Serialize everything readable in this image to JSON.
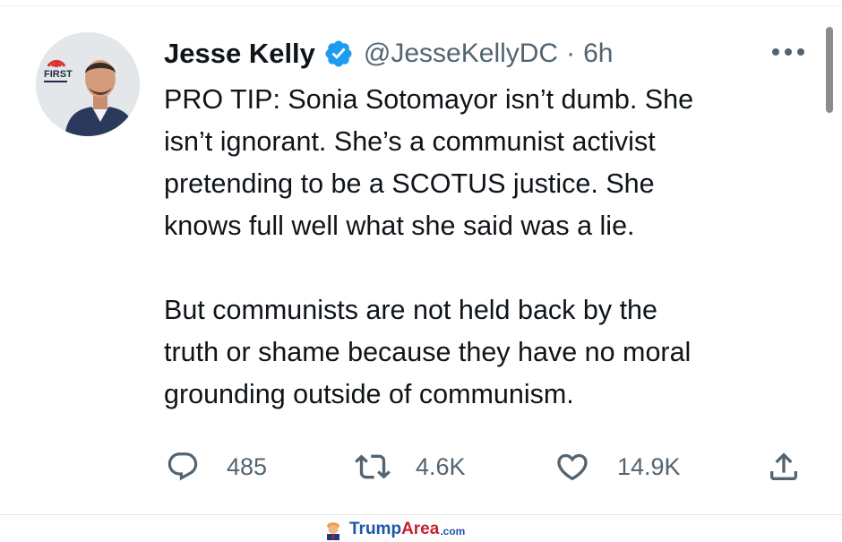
{
  "tweet": {
    "author_name": "Jesse Kelly",
    "handle": "@JesseKellyDC",
    "separator": "·",
    "time": "6h",
    "avatar_badge_text": "FIRST",
    "lines_paragraph_1": [
      "PRO TIP: Sonia Sotomayor isn’t dumb. She",
      "isn’t ignorant. She’s a communist activist",
      "pretending to be a SCOTUS justice. She",
      "knows full well what she said was a lie."
    ],
    "lines_paragraph_2": [
      "But communists are not held back by the",
      "truth or shame because they have no moral",
      "grounding outside of communism."
    ]
  },
  "actions": {
    "replies": "485",
    "retweets": "4.6K",
    "likes": "14.9K"
  },
  "icons": {
    "verified": "verified-badge-icon",
    "more": "more-options-icon",
    "reply": "reply-icon",
    "retweet": "retweet-icon",
    "like": "heart-icon",
    "share": "share-icon"
  },
  "watermark": {
    "brand_a": "Trump",
    "brand_b": "Area",
    "tld": ".com"
  },
  "colors": {
    "text": "#0f1419",
    "secondary": "#536471",
    "verified_blue": "#1d9bf0",
    "watermark_blue": "#1d55a8",
    "watermark_red": "#c8202f"
  }
}
